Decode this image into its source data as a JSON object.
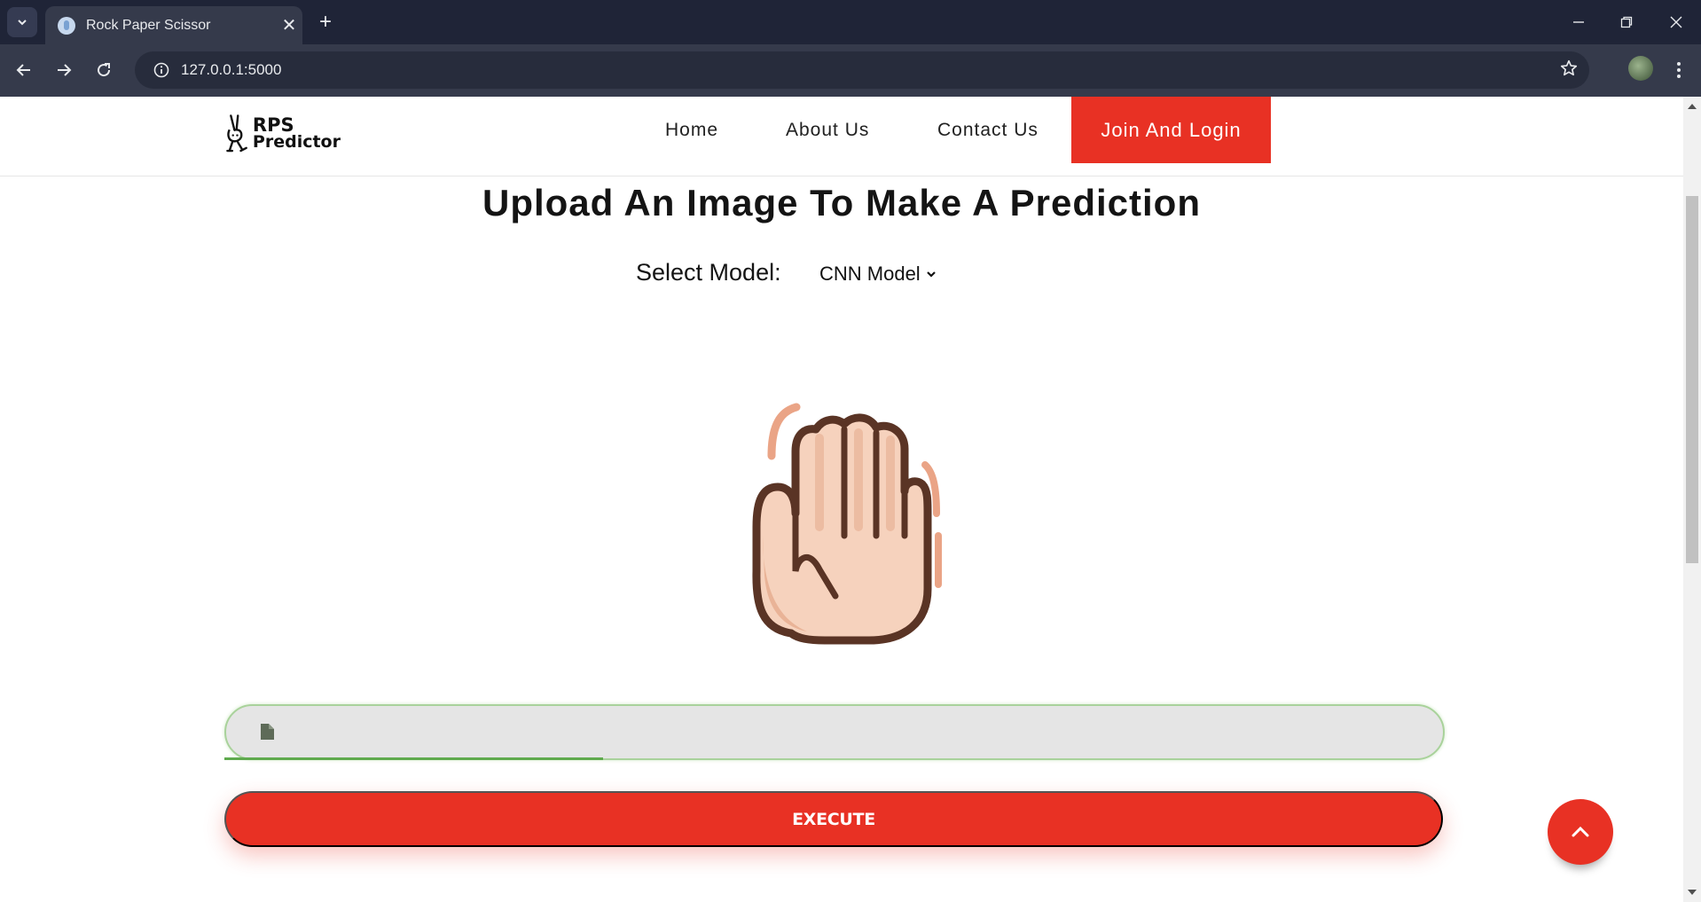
{
  "browser": {
    "tab_title": "Rock Paper Scissor",
    "tab_close": "✕",
    "new_tab": "+",
    "url": "127.0.0.1:5000"
  },
  "header": {
    "logo_line1": "RPS",
    "logo_line2": "Predictor",
    "nav": {
      "home": "Home",
      "about": "About Us",
      "contact": "Contact Us",
      "join": "Join And Login"
    }
  },
  "main": {
    "heading": "Upload An Image To Make A Prediction",
    "model_label": "Select Model:",
    "model_selected": "CNN Model",
    "image_icon": "raised-hand-icon",
    "file_input_icon": "file-icon",
    "upload_progress": 0.31,
    "execute_label": "EXECUTE"
  },
  "colors": {
    "brand_red": "#e83124",
    "tabbar": "#1f2437",
    "toolbar": "#353a4b",
    "field_border": "#a9d29b"
  }
}
